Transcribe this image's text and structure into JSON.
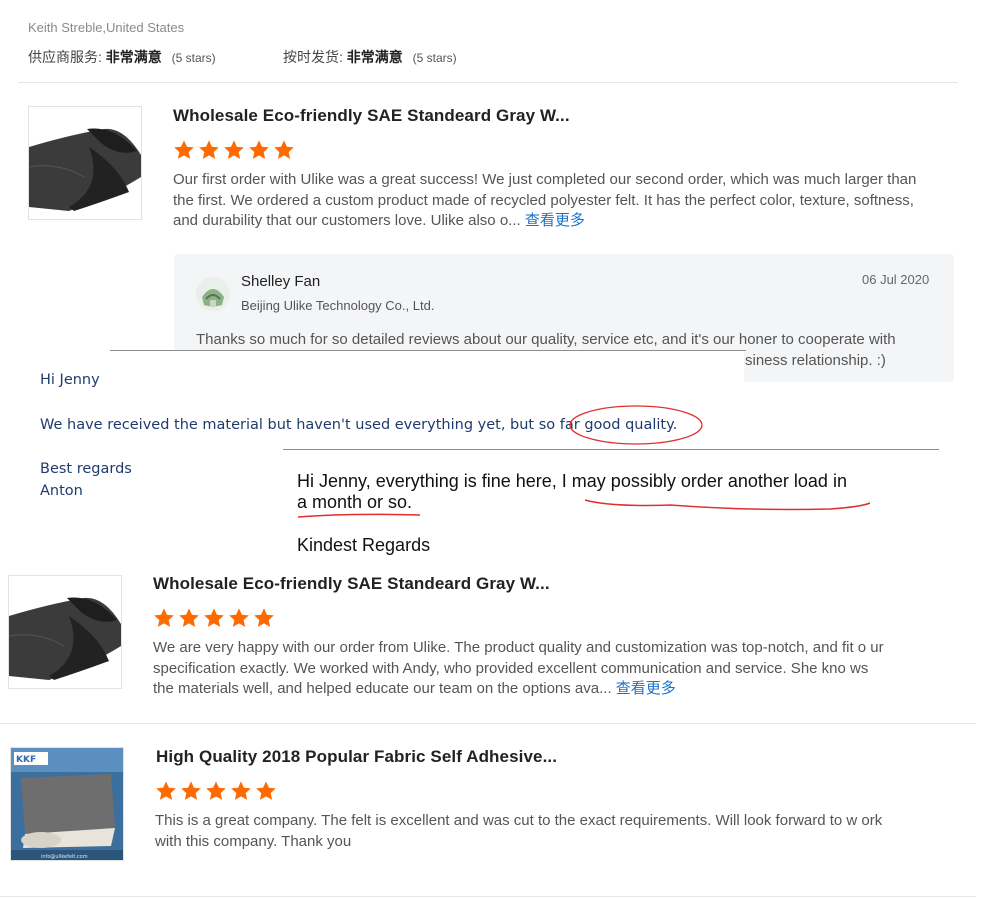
{
  "header": {
    "reviewer": "Keith Streble,United States",
    "ratings": [
      {
        "label": "供应商服务:",
        "value": "非常满意",
        "stars_text": "(5 stars)"
      },
      {
        "label": "按时发货:",
        "value": "非常满意",
        "stars_text": "(5 stars)"
      }
    ]
  },
  "reviews": [
    {
      "title": "Wholesale Eco-friendly SAE Standeard Gray W...",
      "stars": 5,
      "text": "Our first order with Ulike was a great success! We just completed our second order, which was much larger than the first. We ordered a custom product made of recycled polyester felt. It has the perfect color, texture, softness, and durability that our customers love. Ulike also o...",
      "more_label": "查看更多"
    },
    {
      "title": "Wholesale Eco-friendly SAE Standeard Gray W...",
      "stars": 5,
      "text": "We are very happy with our order from Ulike. The product quality and customization was top-notch, and fit o ur specification exactly. We worked with Andy, who provided excellent communication and service. She kno ws the materials well, and helped educate our team on the options ava...",
      "more_label": "查看更多"
    },
    {
      "title": "High Quality 2018 Popular Fabric Self Adhesive...",
      "stars": 5,
      "text": "This is a great company. The felt is excellent and was cut to the exact requirements. Will look forward to w ork with this company. Thank you",
      "badge_text": "KKF",
      "thumb_footer": "info@ulikefelt.com"
    }
  ],
  "reply": {
    "name": "Shelley Fan",
    "company": "Beijing Ulike Technology Co., Ltd.",
    "date": "06 Jul 2020",
    "text": "Thanks so much for so detailed reviews about our quality, service etc, and it's our honer to cooperate with",
    "text_tail": "siness relationship. :)"
  },
  "email_snippet": {
    "greeting": "Hi Jenny",
    "body": "We have received the material but haven't used everything yet, but so far good quality.",
    "regards": "Best regards",
    "name": "Anton"
  },
  "note_snippet": {
    "line1": "Hi Jenny, everything is fine here, I may possibly order another load in",
    "line2": "a month or so.",
    "closing": "Kindest Regards"
  },
  "colors": {
    "star": "#ff6a00",
    "link": "#1a73c8",
    "annotation": "#e03030"
  }
}
